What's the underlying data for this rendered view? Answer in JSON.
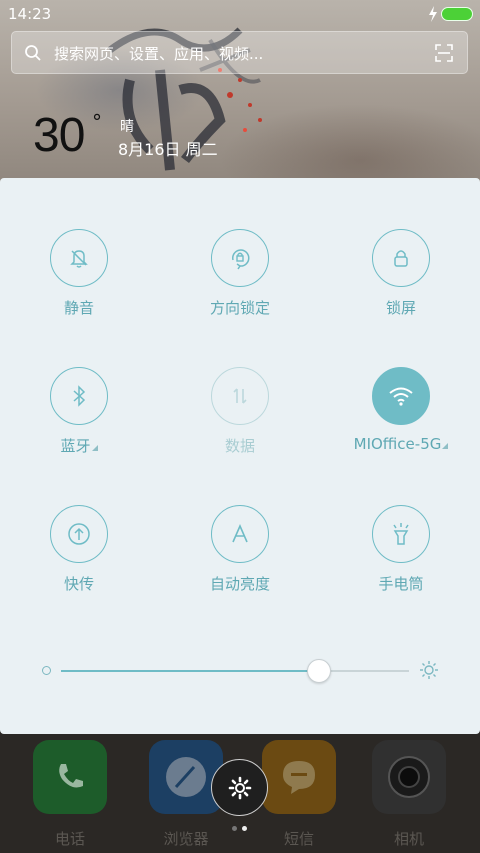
{
  "status_bar": {
    "time": "14:23",
    "battery_color": "#4cd137"
  },
  "search": {
    "placeholder": "搜索网页、设置、应用、视频..."
  },
  "weather": {
    "temperature": "30",
    "degree_symbol": "°",
    "condition": "晴",
    "date": "8月16日 周二"
  },
  "quick_settings": {
    "accent_color": "#6fbcc6",
    "tiles": [
      {
        "label": "静音",
        "icon": "bell-off-icon",
        "state": "off"
      },
      {
        "label": "方向锁定",
        "icon": "rotation-lock-icon",
        "state": "off"
      },
      {
        "label": "锁屏",
        "icon": "lock-icon",
        "state": "off"
      },
      {
        "label": "蓝牙",
        "icon": "bluetooth-icon",
        "state": "off"
      },
      {
        "label": "数据",
        "icon": "mobile-data-icon",
        "state": "disabled"
      },
      {
        "label": "MIOffice-5G",
        "icon": "wifi-icon",
        "state": "on"
      },
      {
        "label": "快传",
        "icon": "quick-transfer-icon",
        "state": "off"
      },
      {
        "label": "自动亮度",
        "icon": "auto-brightness-icon",
        "state": "off"
      },
      {
        "label": "手电筒",
        "icon": "flashlight-icon",
        "state": "off"
      }
    ]
  },
  "brightness": {
    "level_fraction": 0.74
  },
  "dock": {
    "apps": [
      {
        "label": "电话",
        "icon": "phone-icon",
        "color": "#1d5c2a"
      },
      {
        "label": "浏览器",
        "icon": "browser-icon",
        "color": "#1c3f63"
      },
      {
        "label": "短信",
        "icon": "message-icon",
        "color": "#6b4a12"
      },
      {
        "label": "相机",
        "icon": "camera-icon",
        "color": "#303030"
      }
    ]
  },
  "page_indicator": {
    "count": 2,
    "active": 1
  }
}
